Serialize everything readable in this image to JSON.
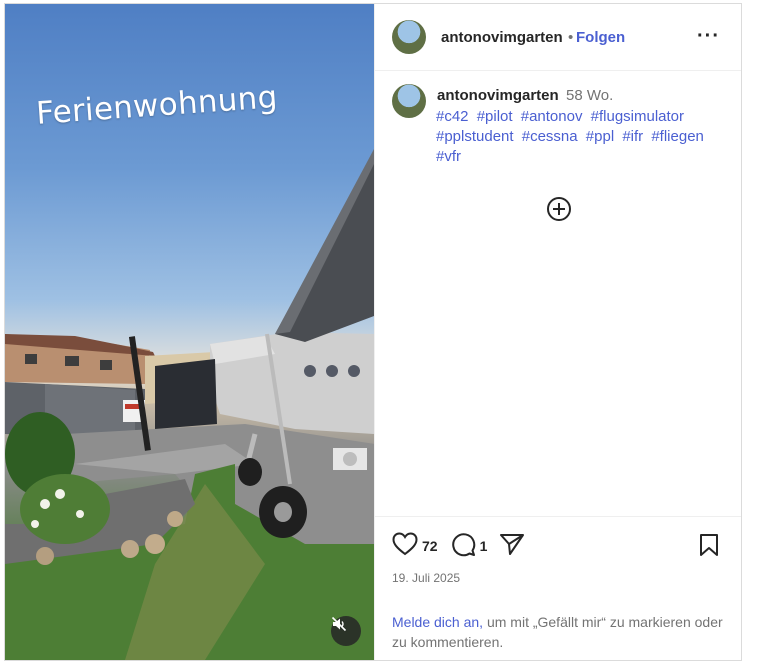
{
  "media": {
    "overlay_text": "Ferienwohnung",
    "mute_icon": "speaker-muted-icon"
  },
  "header": {
    "username": "antonovimgarten",
    "separator": "•",
    "follow_label": "Folgen",
    "more_label": "···"
  },
  "caption": {
    "username": "antonovimgarten",
    "time_ago": "58 Wo.",
    "hashtags": [
      "#c42",
      "#pilot",
      "#antonov",
      "#flugsimulator",
      "#pplstudent",
      "#cessna",
      "#ppl",
      "#ifr",
      "#fliegen",
      "#vfr"
    ]
  },
  "footer": {
    "likes_count": "72",
    "comments_count": "1",
    "date": "19. Juli 2025",
    "login_link": "Melde dich an,",
    "login_rest": " um mit „Gefällt mir“ zu markieren oder zu kommentieren."
  },
  "colors": {
    "link_blue": "#4a5fd1",
    "text": "#262626",
    "muted": "#737373",
    "border": "#dbdbdb"
  }
}
